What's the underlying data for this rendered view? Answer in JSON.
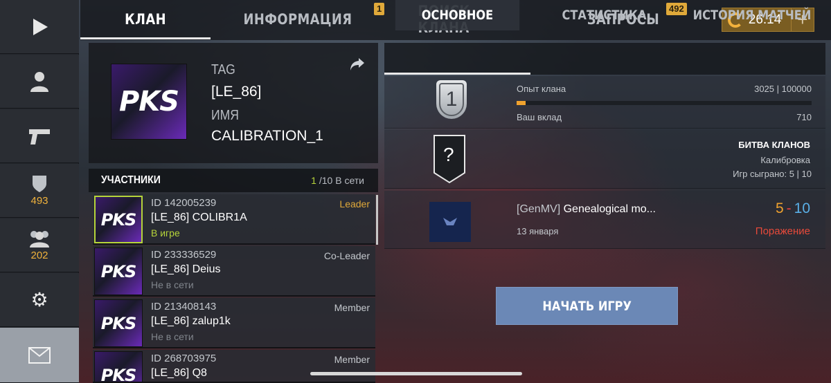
{
  "sidebar": {
    "items": [
      {
        "icon": "play-icon",
        "count": ""
      },
      {
        "icon": "profile-icon",
        "count": ""
      },
      {
        "icon": "pistol-icon",
        "count": ""
      },
      {
        "icon": "rank-shield-icon",
        "count": "493"
      },
      {
        "icon": "friends-icon",
        "count": "202"
      },
      {
        "icon": "gear-icon",
        "count": ""
      },
      {
        "icon": "mail-icon",
        "count": ""
      }
    ]
  },
  "top_tabs": [
    {
      "label": "КЛАН",
      "active": true,
      "badge": ""
    },
    {
      "label": "ИНФОРМАЦИЯ",
      "active": false,
      "badge": "1"
    },
    {
      "label": "ПОИСК КЛАНА",
      "active": false,
      "badge": ""
    },
    {
      "label": "ЗАПРОСЫ",
      "active": false,
      "badge": "492"
    }
  ],
  "currency": {
    "amount": "26.14",
    "plus": "+",
    "color": "#f4b23c"
  },
  "clan": {
    "logo_text": "PKS",
    "tag_label": "TAG",
    "tag_value": "[LE_86]",
    "name_label": "ИМЯ",
    "name_value": "CALIBRATION_1"
  },
  "members": {
    "title": "УЧАСТНИКИ",
    "online_count": "1",
    "online_rest": "/10 В сети",
    "rows": [
      {
        "id": "ID 142005239",
        "name": "[LE_86] COLIBR1A",
        "status": "В игре",
        "role": "Leader",
        "in_game": true
      },
      {
        "id": "ID 233336529",
        "name": "[LE_86] Deius",
        "status": "Не в сети",
        "role": "Co-Leader",
        "in_game": false
      },
      {
        "id": "ID 213408143",
        "name": "[LE_86] zalup1k",
        "status": "Не в сети",
        "role": "Member",
        "in_game": false
      },
      {
        "id": "ID 268703975",
        "name": "[LE_86] Q8",
        "status": "",
        "role": "Member",
        "in_game": false
      }
    ]
  },
  "sub_tabs": [
    {
      "label": "ОСНОВНОЕ",
      "active": true
    },
    {
      "label": "СТАТИСТИКА",
      "active": false
    },
    {
      "label": "ИСТОРИЯ МАТЧЕЙ",
      "active": false
    }
  ],
  "overview": {
    "level": "1",
    "xp_label": "Опыт клана",
    "xp_value": "3025 | 100000",
    "xp_progress": 0.03025,
    "contrib_label": "Ваш вклад",
    "contrib_value": "710",
    "battle_badge": "?",
    "battle_title": "БИТВА КЛАНОВ",
    "battle_sub": "Калибровка",
    "battle_played": "Игр сыграно: 5 | 10"
  },
  "last_match": {
    "opponent_tag": "[GenMV]",
    "opponent_name": "Genealogical mo...",
    "date": "13 января",
    "score_own": "5",
    "score_sep": "-",
    "score_opp": "10",
    "result": "Поражение",
    "result_color": "#e84a3a"
  },
  "start_button": "НАЧАТЬ ИГРУ"
}
